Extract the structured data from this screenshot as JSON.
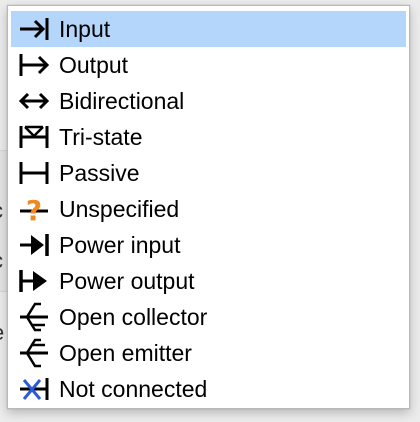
{
  "background": {
    "fragments": [
      "c",
      "c",
      "e"
    ]
  },
  "menu": {
    "items": [
      {
        "label": "Input",
        "icon": "input-pin-icon",
        "selected": true
      },
      {
        "label": "Output",
        "icon": "output-pin-icon",
        "selected": false
      },
      {
        "label": "Bidirectional",
        "icon": "bidirectional-pin-icon",
        "selected": false
      },
      {
        "label": "Tri-state",
        "icon": "tristate-pin-icon",
        "selected": false
      },
      {
        "label": "Passive",
        "icon": "passive-pin-icon",
        "selected": false
      },
      {
        "label": "Unspecified",
        "icon": "unspecified-pin-icon",
        "selected": false
      },
      {
        "label": "Power input",
        "icon": "power-input-pin-icon",
        "selected": false
      },
      {
        "label": "Power output",
        "icon": "power-output-pin-icon",
        "selected": false
      },
      {
        "label": "Open collector",
        "icon": "open-collector-pin-icon",
        "selected": false
      },
      {
        "label": "Open emitter",
        "icon": "open-emitter-pin-icon",
        "selected": false
      },
      {
        "label": "Not connected",
        "icon": "not-connected-pin-icon",
        "selected": false
      }
    ],
    "colors": {
      "selection": "#b4d6fb",
      "unspecified_icon": "#f08a1c",
      "not_connected_icon": "#2a5bd7"
    }
  }
}
